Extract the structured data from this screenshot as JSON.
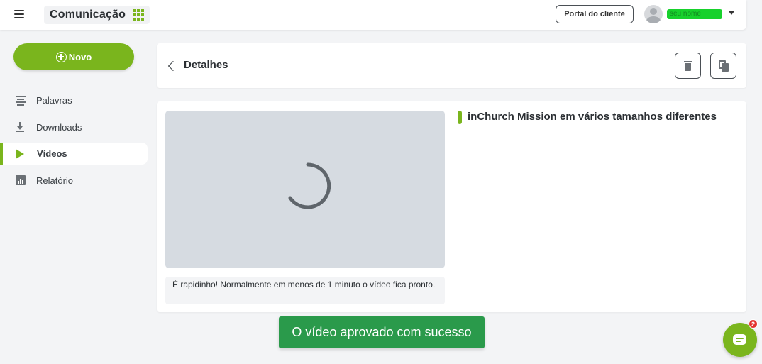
{
  "header": {
    "app_title": "Comunicação",
    "portal_button": "Portal do cliente",
    "user_name": "seu nome"
  },
  "sidebar": {
    "new_button": "Novo",
    "items": [
      {
        "label": "Palavras",
        "icon": "lines-icon",
        "active": false
      },
      {
        "label": "Downloads",
        "icon": "download-icon",
        "active": false
      },
      {
        "label": "Vídeos",
        "icon": "play-icon",
        "active": true
      },
      {
        "label": "Relatório",
        "icon": "report-icon",
        "active": false
      }
    ]
  },
  "details": {
    "title": "Detalhes"
  },
  "video": {
    "title": "inChurch Mission em vários tamanhos diferentes",
    "hint": "É rapidinho! Normalmente em menos de 1 minuto o vídeo fica pronto."
  },
  "toast": {
    "message": "O vídeo aprovado com sucesso"
  },
  "chat": {
    "badge_count": "2"
  },
  "colors": {
    "accent": "#7ab51d",
    "toast": "#2a9a4b",
    "badge": "#e3342f"
  }
}
